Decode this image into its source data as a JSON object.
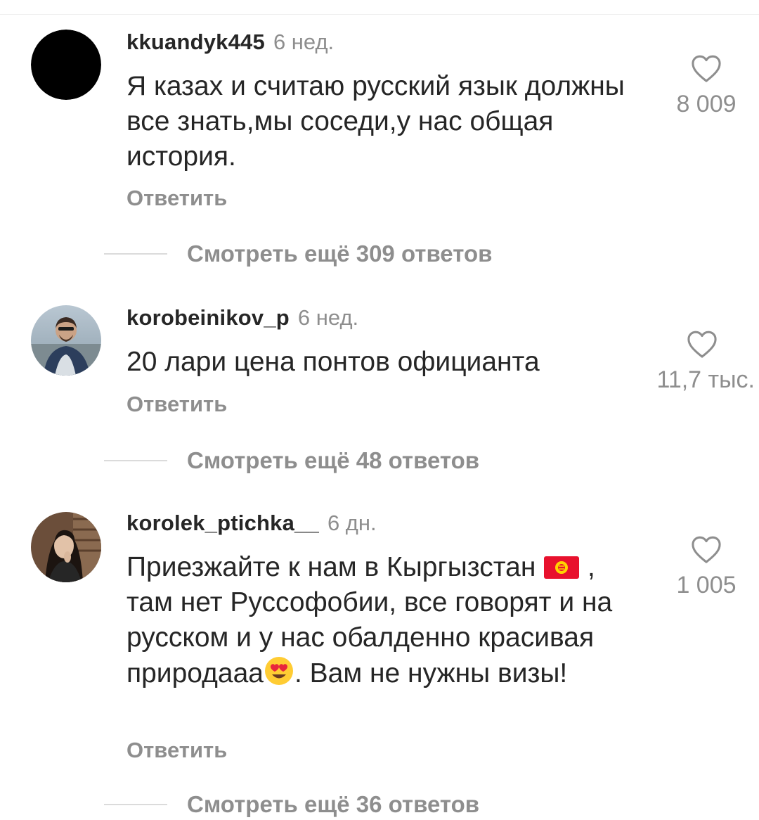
{
  "comments": [
    {
      "username": "kkuandyk445",
      "time": "6 нед.",
      "text": "Я казах и считаю русский язык должны все знать,мы соседи,у нас общая история.",
      "reply_label": "Ответить",
      "likes": "8 009",
      "more_replies": "Смотреть ещё 309 ответов"
    },
    {
      "username": "korobeinikov_p",
      "time": "6 нед.",
      "text": "20 лари цена понтов официанта",
      "reply_label": "Ответить",
      "likes": "11,7 тыс.",
      "more_replies": "Смотреть ещё 48 ответов"
    },
    {
      "username": "korolek_ptichka__",
      "time": "6 дн.",
      "text_part1": "Приезжайте к нам в Кыргызстан",
      "text_part2": ", там нет Руссофобии, все говорят и на русском и у нас обалденно красивая природааа",
      "text_part3": ". Вам не нужны визы!",
      "reply_label": "Ответить",
      "likes": "1 005",
      "more_replies": "Смотреть ещё 36 ответов"
    }
  ],
  "icons": {
    "like": "heart-outline-icon",
    "flag": "kyrgyzstan-flag-emoji",
    "emoji": "heart-eyes-emoji"
  },
  "colors": {
    "text": "#262626",
    "secondary": "#8e8e8e",
    "divider": "#dbdbdb"
  }
}
